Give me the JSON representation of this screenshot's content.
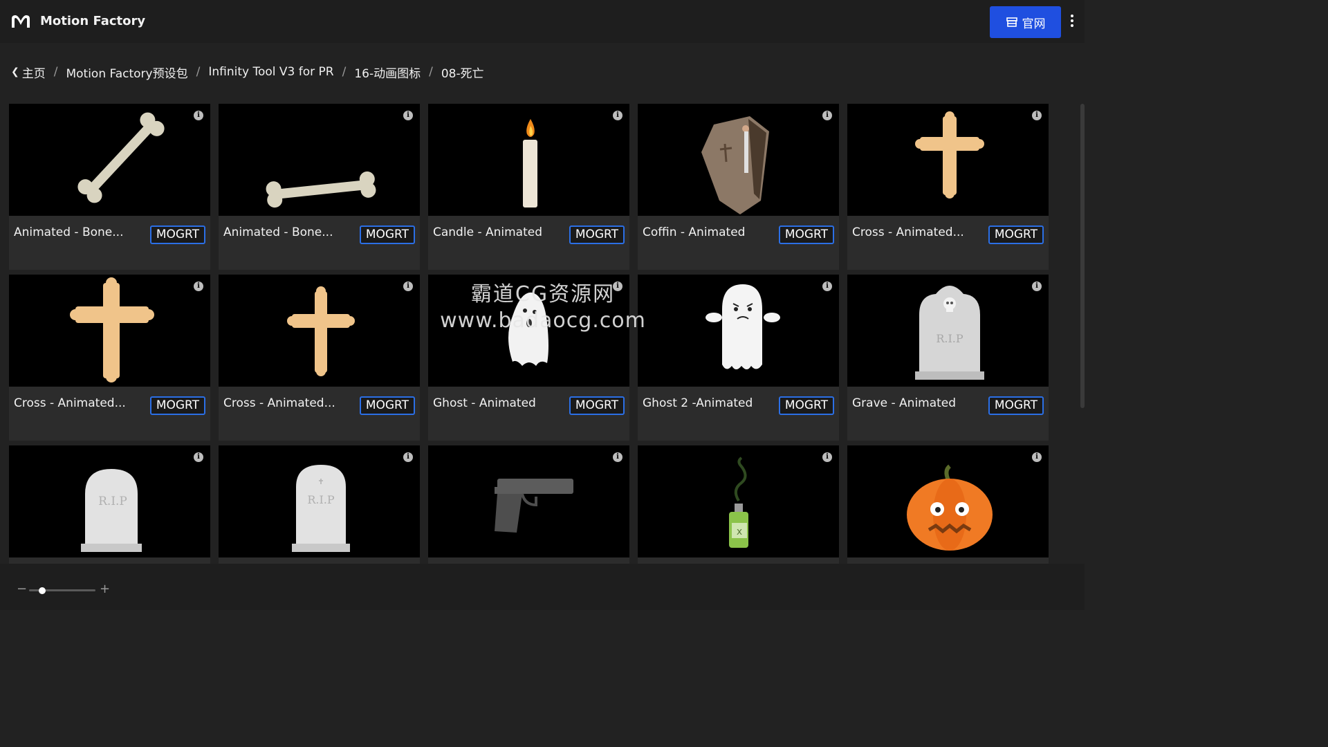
{
  "app": {
    "title": "Motion Factory",
    "site_button": "官网"
  },
  "breadcrumb": [
    "主页",
    "Motion Factory预设包",
    "Infinity Tool V3 for PR",
    "16-动画图标",
    "08-死亡"
  ],
  "cards": [
    {
      "title": "Animated - Bone...",
      "badge": "MOGRT",
      "art": "bone-diagonal"
    },
    {
      "title": "Animated - Bone...",
      "badge": "MOGRT",
      "art": "bone-horizontal"
    },
    {
      "title": "Candle - Animated",
      "badge": "MOGRT",
      "art": "candle"
    },
    {
      "title": "Coffin - Animated",
      "badge": "MOGRT",
      "art": "coffin"
    },
    {
      "title": "Cross - Animated...",
      "badge": "MOGRT",
      "art": "cross"
    },
    {
      "title": "Cross - Animated...",
      "badge": "MOGRT",
      "art": "cross-large"
    },
    {
      "title": "Cross - Animated...",
      "badge": "MOGRT",
      "art": "cross"
    },
    {
      "title": "Ghost - Animated",
      "badge": "MOGRT",
      "art": "ghost"
    },
    {
      "title": "Ghost 2 -Animated",
      "badge": "MOGRT",
      "art": "ghost-angry"
    },
    {
      "title": "Grave - Animated",
      "badge": "MOGRT",
      "art": "grave-skull"
    },
    {
      "title": "",
      "badge": "",
      "art": "tombstone"
    },
    {
      "title": "",
      "badge": "",
      "art": "tombstone-cross"
    },
    {
      "title": "",
      "badge": "",
      "art": "gun"
    },
    {
      "title": "",
      "badge": "",
      "art": "poison"
    },
    {
      "title": "",
      "badge": "",
      "art": "pumpkin"
    }
  ],
  "art_text": {
    "rip": "R.I.P"
  },
  "zoom": {
    "level": 0.2
  },
  "watermark": {
    "line1": "霸道CG资源网",
    "line2": "www.badaocg.com"
  },
  "colors": {
    "accent": "#1f4fe0",
    "badge_border": "#2b6fe6",
    "bone": "#d9d4c0",
    "cross": "#f0c48a"
  }
}
